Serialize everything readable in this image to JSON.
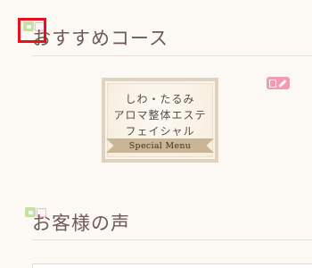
{
  "sections": {
    "recommended_title": "おすすめコース",
    "voice_title": "お客様の声"
  },
  "menu_card": {
    "lines": [
      "しわ・たるみ",
      "アロマ整体エステ",
      "フェイシャル"
    ],
    "ribbon_label": "Special Menu"
  },
  "icons": {
    "section_edit": "edit-block-icon",
    "card_edit": "edit-pencil-icon"
  },
  "colors": {
    "background": "#fcf8f4",
    "title": "#6f5a56",
    "selection": "#e8101c",
    "edit_pink": "#f39ab3",
    "edit_green": "#c5dfa6",
    "card_border": "#e1d2bf",
    "ribbon": "#c8b595"
  }
}
